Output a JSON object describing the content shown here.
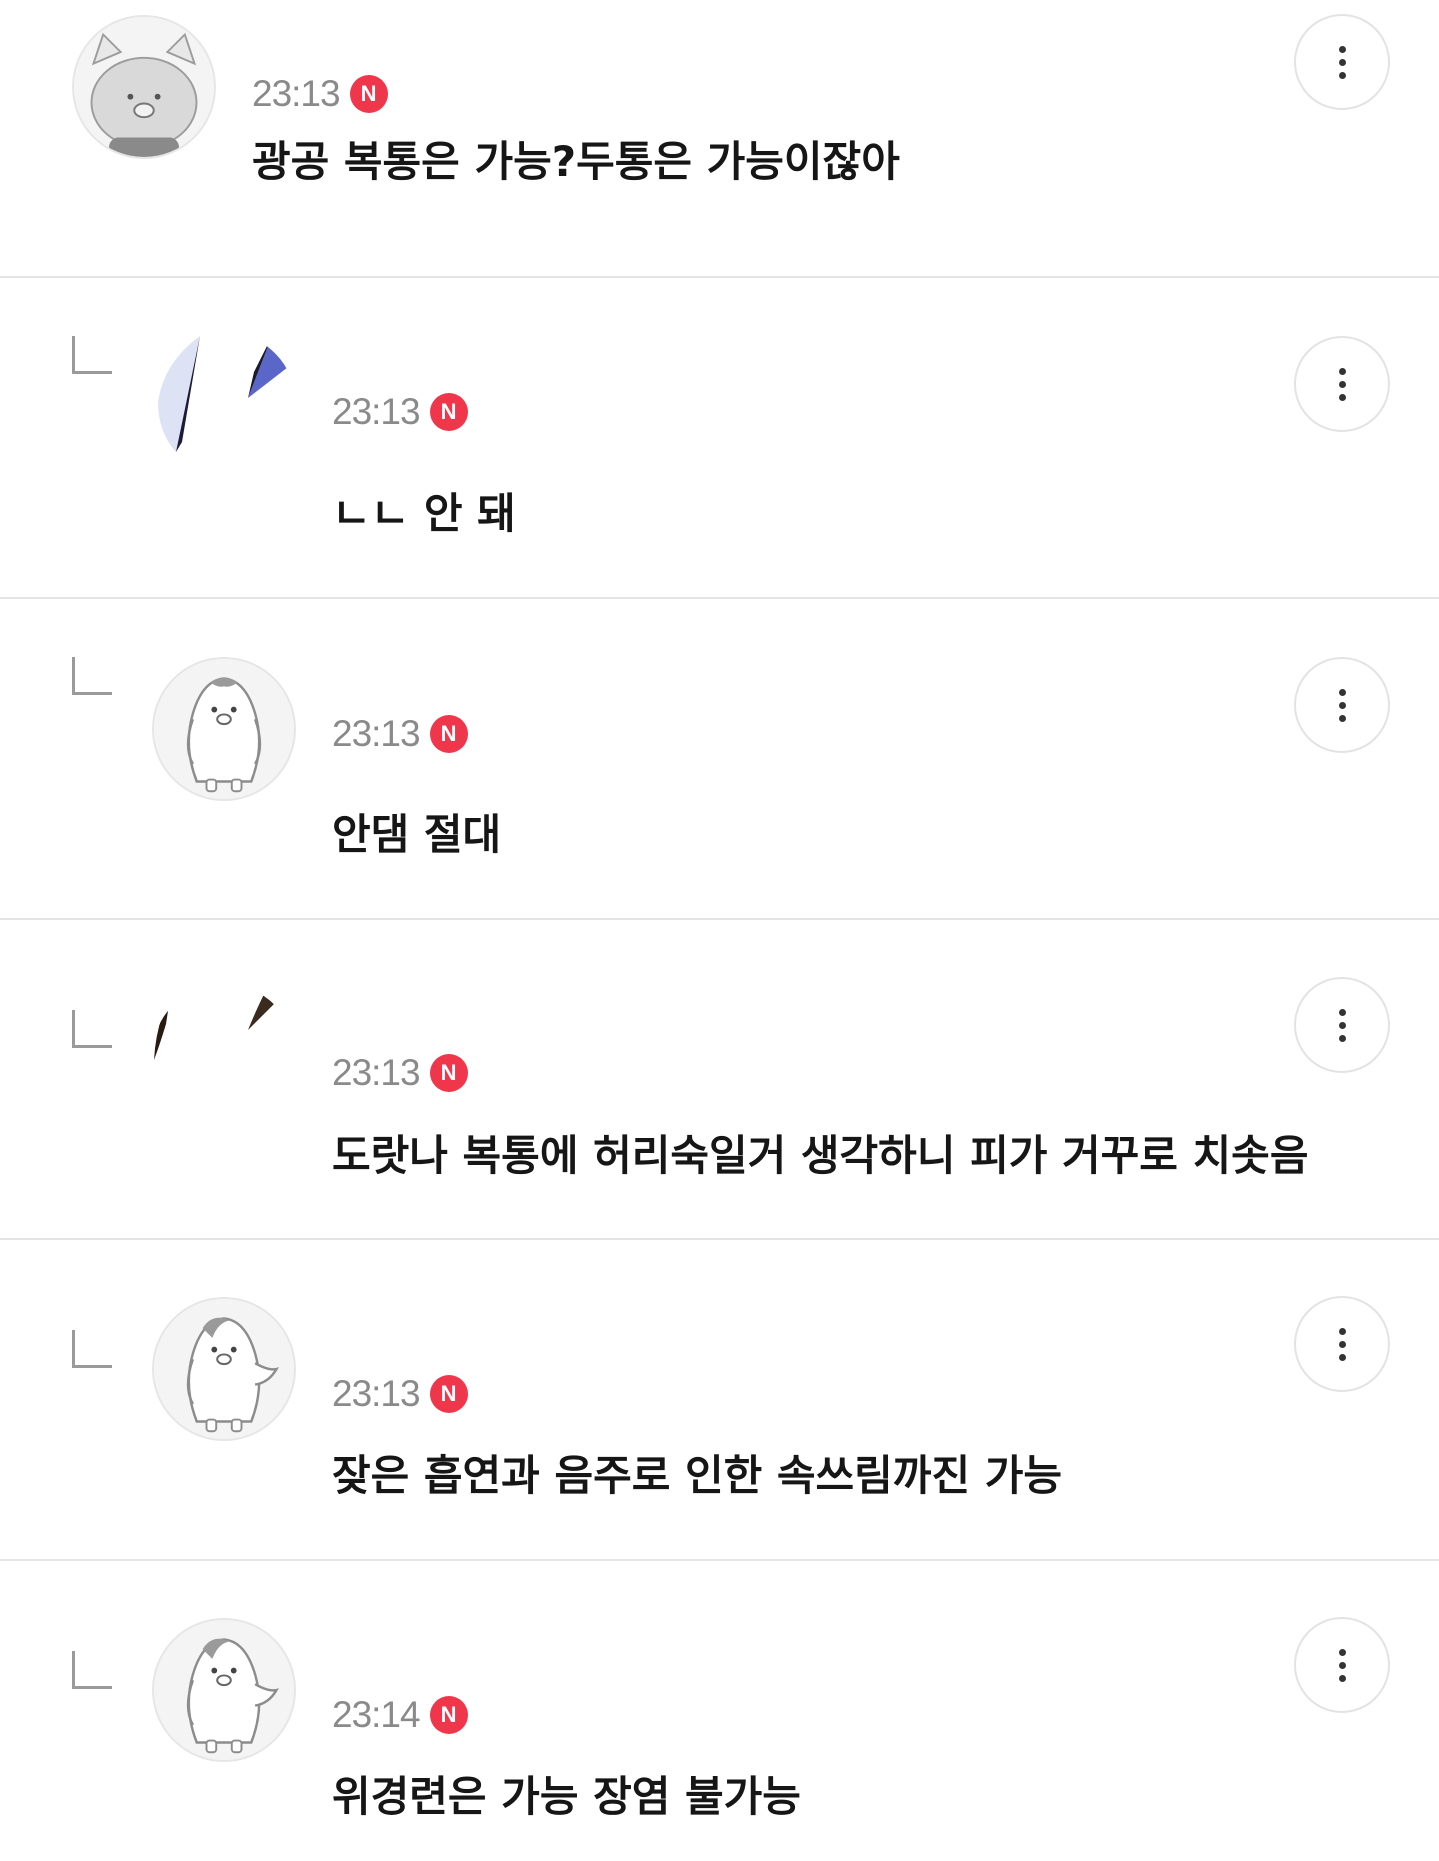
{
  "comments": [
    {
      "nickname": "",
      "time": "23:13",
      "badge": "N",
      "text": "광공 복통은 가능?두통은 가능이잖아",
      "avatar_icon": "cat-avatar-icon",
      "is_reply": false
    },
    {
      "nickname": "",
      "time": "23:13",
      "badge": "N",
      "text": "ㄴㄴ 안 돼",
      "avatar_icon": "photo-avatar-icon",
      "is_reply": true
    },
    {
      "nickname": "",
      "time": "23:13",
      "badge": "N",
      "text": "안댐 절대",
      "avatar_icon": "penguin-avatar-icon",
      "is_reply": true
    },
    {
      "nickname": "",
      "time": "23:13",
      "badge": "N",
      "text": "도랏나 복통에 허리숙일거 생각하니 피가 거꾸로 치솟음",
      "avatar_icon": "photo-avatar-icon",
      "is_reply": true
    },
    {
      "nickname": "",
      "time": "23:13",
      "badge": "N",
      "text": "잦은 흡연과 음주로 인한 속쓰림까진 가능",
      "avatar_icon": "penguin-avatar-icon",
      "is_reply": true
    },
    {
      "nickname": "",
      "time": "23:14",
      "badge": "N",
      "text": "위경련은 가능 장염 불가능",
      "avatar_icon": "penguin-avatar-icon",
      "is_reply": true
    }
  ],
  "icons": {
    "more": "more-vertical-icon",
    "reply": "reply-arrow-icon",
    "badge": "new-badge-icon"
  },
  "colors": {
    "badge": "#f0364a",
    "time": "#8a8a8a",
    "divider": "#e4e4e4"
  }
}
